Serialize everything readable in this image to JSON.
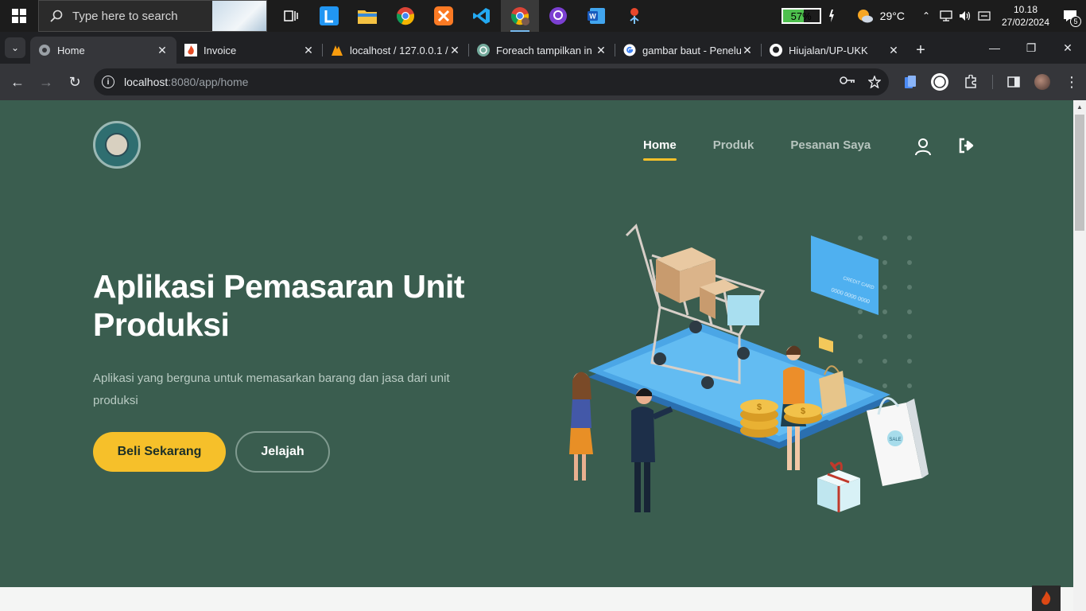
{
  "taskbar": {
    "search_placeholder": "Type here to search",
    "battery_percent": "57%",
    "weather_temp": "29°C",
    "time": "10.18",
    "date": "27/02/2024",
    "notification_count": "5"
  },
  "browser": {
    "tabs": [
      {
        "title": "Home"
      },
      {
        "title": "Invoice"
      },
      {
        "title": "localhost / 127.0.0.1 /"
      },
      {
        "title": "Foreach tampilkan in"
      },
      {
        "title": "gambar baut - Penelu"
      },
      {
        "title": "Hiujalan/UP-UKK"
      }
    ],
    "url_host": "localhost",
    "url_path": ":8080/app/home"
  },
  "page": {
    "nav": {
      "home": "Home",
      "produk": "Produk",
      "pesanan": "Pesanan Saya"
    },
    "hero": {
      "title": "Aplikasi Pemasaran Unit Produksi",
      "subtitle": "Aplikasi yang berguna untuk memasarkan barang dan jasa dari unit produksi",
      "primary_button": "Beli Sekarang",
      "secondary_button": "Jelajah"
    },
    "illustration_text": {
      "credit_card": "CREDIT CARD",
      "card_number": "0000 0000 0000",
      "sale": "SALE"
    }
  },
  "colors": {
    "hero_bg": "#3a5d4f",
    "accent": "#f6c02a"
  }
}
